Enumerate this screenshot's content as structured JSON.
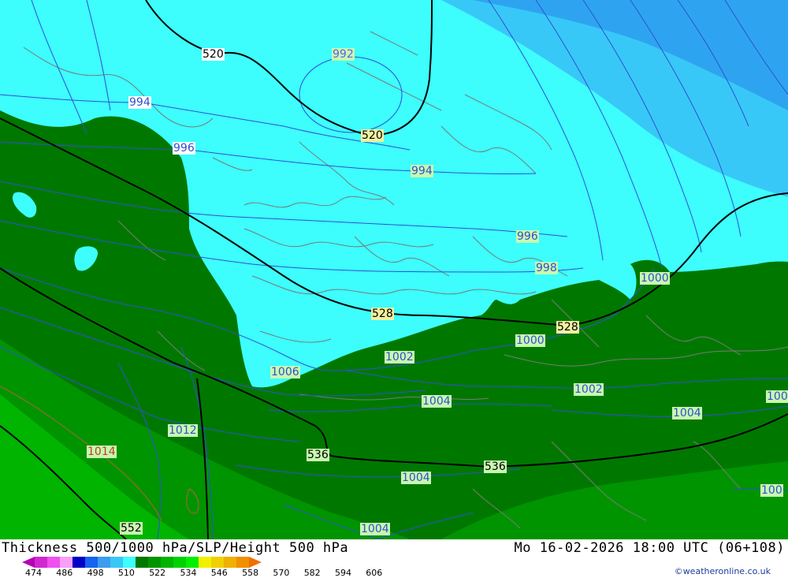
{
  "title": "Thickness 500/1000 hPa/SLP/Height 500 hPa",
  "datetime": "Mo 16-02-2026 18:00 UTC (06+108)",
  "credit": "©weatheronline.co.uk",
  "colors": {
    "cyan": "#3dfdfd",
    "light_blue": "#38c8f8",
    "blue": "#2ea4f0",
    "dark_green": "#007800",
    "mid_green": "#009400",
    "bright_green": "#00b400",
    "isobar": "#3050d0",
    "height": "#000000",
    "border": "#7a7a7a",
    "label_bg": "#c8f8b0"
  },
  "legend": {
    "values": [
      "474",
      "486",
      "498",
      "510",
      "522",
      "534",
      "546",
      "558",
      "570",
      "582",
      "594",
      "606"
    ],
    "colors": [
      "#b400b4",
      "#d028d0",
      "#f050f0",
      "#f8a0f8",
      "#0000c8",
      "#1464f0",
      "#3c9cf0",
      "#38c8f8",
      "#3dfdfd",
      "#007800",
      "#009400",
      "#00b400",
      "#00d200",
      "#00f000",
      "#f0f000",
      "#f0d000",
      "#f0b000",
      "#f09000",
      "#f07000"
    ]
  },
  "isobar_labels": [
    {
      "text": "992"
    },
    {
      "text": "994"
    },
    {
      "text": "994"
    },
    {
      "text": "996"
    },
    {
      "text": "996"
    },
    {
      "text": "998"
    },
    {
      "text": "1000"
    },
    {
      "text": "1000"
    },
    {
      "text": "1002"
    },
    {
      "text": "1002"
    },
    {
      "text": "1004"
    },
    {
      "text": "1004"
    },
    {
      "text": "1004"
    },
    {
      "text": "1004"
    },
    {
      "text": "1006"
    },
    {
      "text": "1012"
    },
    {
      "text": "1014"
    },
    {
      "text": "100"
    },
    {
      "text": "100"
    }
  ],
  "height_labels": [
    {
      "text": "520"
    },
    {
      "text": "520"
    },
    {
      "text": "528"
    },
    {
      "text": "528"
    },
    {
      "text": "536"
    },
    {
      "text": "536"
    },
    {
      "text": "552"
    }
  ]
}
